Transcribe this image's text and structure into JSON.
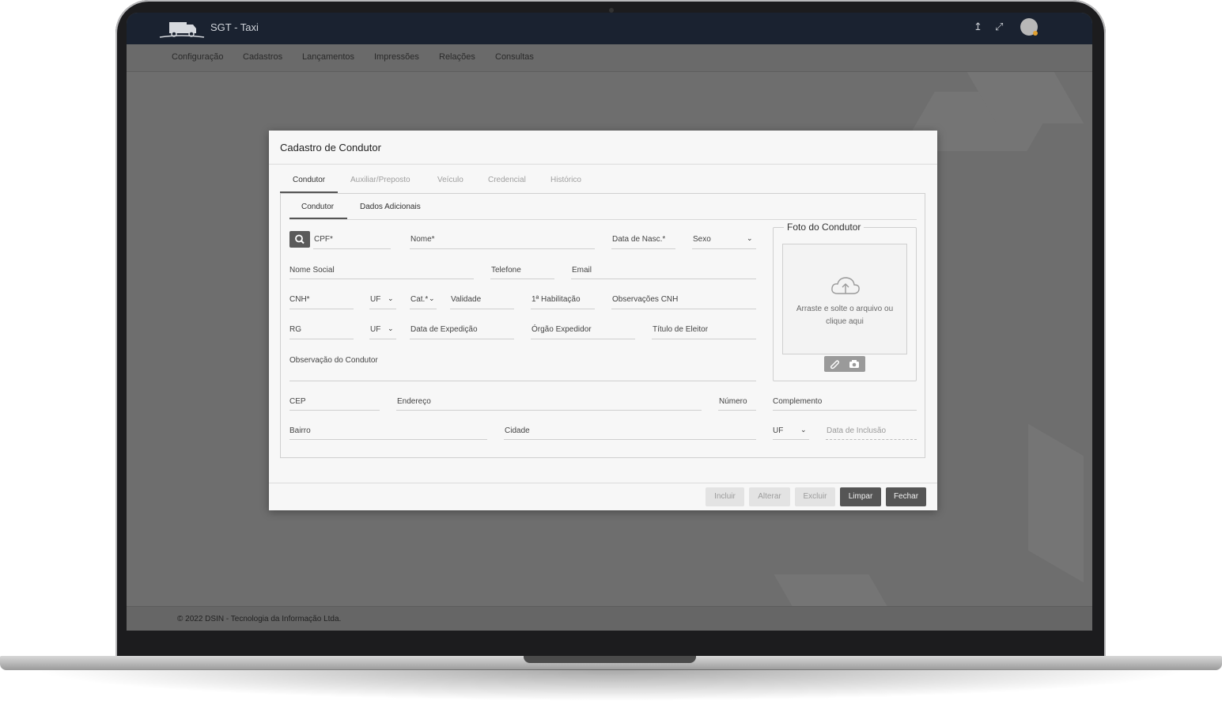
{
  "app": {
    "title": "SGT - Taxi"
  },
  "menu": [
    "Configuração",
    "Cadastros",
    "Lançamentos",
    "Impressões",
    "Relações",
    "Consultas"
  ],
  "footer": {
    "text": "© 2022 DSIN - Tecnologia da Informação Ltda."
  },
  "modal": {
    "title": "Cadastro de Condutor",
    "tabs": [
      "Condutor",
      "Auxiliar/Preposto",
      "Veículo",
      "Credencial",
      "Histórico"
    ],
    "active_tab": "Condutor",
    "subtabs": [
      "Condutor",
      "Dados Adicionais"
    ],
    "fields": {
      "cpf": "CPF*",
      "nome": "Nome*",
      "data_nasc": "Data de Nasc.*",
      "sexo": "Sexo",
      "nome_social": "Nome Social",
      "telefone": "Telefone",
      "email": "Email",
      "cnh": "CNH*",
      "uf_cnh": "UF",
      "cat": "Cat.*",
      "validade": "Validade",
      "primeira_hab": "1ª Habilitação",
      "obs_cnh": "Observações CNH",
      "rg": "RG",
      "uf_rg": "UF",
      "data_expedicao": "Data de Expedição",
      "orgao_expedidor": "Órgão Expedidor",
      "titulo_eleitor": "Título de Eleitor",
      "obs_condutor": "Observação do Condutor",
      "cep": "CEP",
      "endereco": "Endereço",
      "numero": "Número",
      "complemento": "Complemento",
      "bairro": "Bairro",
      "cidade": "Cidade",
      "uf_endereco": "UF",
      "data_inclusao": "Data de Inclusão"
    },
    "photo": {
      "legend": "Foto do Condutor",
      "drop_text": "Arraste e solte o arquivo ou clique aqui"
    },
    "buttons": {
      "incluir": "Incluir",
      "alterar": "Alterar",
      "excluir": "Excluir",
      "limpar": "Limpar",
      "fechar": "Fechar"
    }
  }
}
